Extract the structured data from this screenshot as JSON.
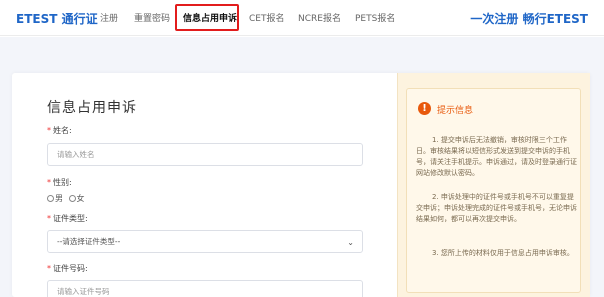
{
  "header": {
    "brand": "ETEST",
    "brand_suffix": "通行证",
    "slogan": "一次注册 畅行ETEST",
    "nav": [
      {
        "label": "注册",
        "active": false
      },
      {
        "label": "重置密码",
        "active": false
      },
      {
        "label": "信息占用申诉",
        "active": true
      },
      {
        "label": "CET报名",
        "active": false
      },
      {
        "label": "NCRE报名",
        "active": false
      },
      {
        "label": "PETS报名",
        "active": false
      }
    ]
  },
  "form": {
    "title": "信息占用申诉",
    "required_mark": "*",
    "name_label": "姓名:",
    "name_placeholder": "请输入姓名",
    "gender_label": "性别:",
    "gender_options": [
      "男",
      "女"
    ],
    "id_type_label": "证件类型:",
    "id_type_value": "--请选择证件类型--",
    "id_number_label": "证件号码:",
    "id_number_placeholder": "请输入证件号码"
  },
  "tips": {
    "icon_symbol": "!",
    "title": "提示信息",
    "items": [
      "1. 提交申诉后无法撤销，审核时限三个工作日。审核结果将以短信形式发送到提交申诉的手机号，请关注手机提示。申诉通过，请及时登录通行证网站修改默认密码。",
      "2. 申诉处理中的证件号或手机号不可以重复提交申诉；申诉处理完成的证件号或手机号，无论申诉结果如何，都可以再次提交申诉。",
      "3. 您所上传的材料仅用于信息占用申诉审核。"
    ]
  },
  "colors": {
    "brand": "#1f66c7",
    "highlight_box": "#e21c1c",
    "tips_accent": "#e8590c",
    "required": "#e33333"
  }
}
